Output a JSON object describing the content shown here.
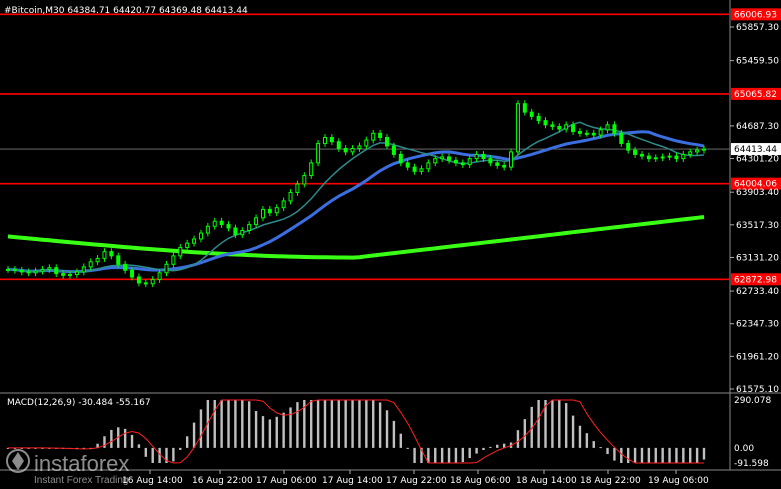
{
  "header": {
    "title": "#Bitcoin,M30  64384.71 64420.77 64369.48 64413.44"
  },
  "price_axis": [
    {
      "v": 65857.3,
      "t": "65857.30"
    },
    {
      "v": 65459.5,
      "t": "65459.50"
    },
    {
      "v": 64687.3,
      "t": "64687.30"
    },
    {
      "v": 64301.2,
      "t": "64301.20"
    },
    {
      "v": 63903.4,
      "t": "63903.40"
    },
    {
      "v": 63517.3,
      "t": "63517.30"
    },
    {
      "v": 63131.2,
      "t": "63131.20"
    },
    {
      "v": 62733.4,
      "t": "62733.40"
    },
    {
      "v": 62347.3,
      "t": "62347.30"
    },
    {
      "v": 61961.2,
      "t": "61961.20"
    },
    {
      "v": 61575.1,
      "t": "61575.10"
    }
  ],
  "levels": [
    {
      "price": 66006.93,
      "label": "66006.93"
    },
    {
      "price": 65065.82,
      "label": "65065.82"
    },
    {
      "price": 64004.06,
      "label": "64004.06"
    },
    {
      "price": 62872.98,
      "label": "62872.98"
    }
  ],
  "current_price": {
    "price": 64413.44,
    "label": "64413.44"
  },
  "time_axis": [
    "16 Aug 14:00",
    "16 Aug 22:00",
    "17 Aug 06:00",
    "17 Aug 14:00",
    "17 Aug 22:00",
    "18 Aug 06:00",
    "18 Aug 14:00",
    "18 Aug 22:00",
    "19 Aug 06:00"
  ],
  "macd": {
    "title": "MACD(12,26,9) -30.484 -55.167",
    "axis_top": "290.078",
    "axis_zero": "0.00",
    "axis_bottom": "-91.598",
    "histogram_max": 290.078,
    "histogram_min": -91.598
  },
  "watermark": {
    "brand": "instaforex",
    "tagline": "Instant Forex Trading"
  },
  "colors": {
    "background": "#000000",
    "candle": "#00ff00",
    "level_line": "#ff0000",
    "ma_fast": "#2e8b8b",
    "ma_mid": "#3b6fe0",
    "ma_slow": "#39ff14",
    "macd_hist": "#c0c0c0",
    "macd_signal": "#ff2020",
    "grid": "#3a3a3a"
  },
  "chart_data": {
    "type": "line",
    "title": "#Bitcoin,M30",
    "ohlc_last": {
      "open": 64384.71,
      "high": 64420.77,
      "low": 64369.48,
      "close": 64413.44
    },
    "ylim": [
      61500,
      66150
    ],
    "close_series": [
      62990,
      62980,
      62960,
      62950,
      62970,
      62990,
      63010,
      62940,
      62920,
      62930,
      62960,
      63020,
      63080,
      63120,
      63200,
      63150,
      63050,
      62980,
      62900,
      62830,
      62820,
      62870,
      62950,
      63050,
      63150,
      63250,
      63300,
      63350,
      63420,
      63500,
      63560,
      63520,
      63480,
      63400,
      63450,
      63520,
      63600,
      63700,
      63660,
      63720,
      63800,
      63900,
      64000,
      64100,
      64250,
      64480,
      64550,
      64500,
      64420,
      64380,
      64420,
      64450,
      64520,
      64600,
      64550,
      64450,
      64350,
      64250,
      64200,
      64150,
      64180,
      64250,
      64300,
      64320,
      64280,
      64250,
      64230,
      64300,
      64350,
      64300,
      64250,
      64220,
      64200,
      64380,
      64950,
      64850,
      64800,
      64750,
      64700,
      64680,
      64650,
      64700,
      64620,
      64600,
      64600,
      64580,
      64640,
      64700,
      64600,
      64480,
      64400,
      64350,
      64330,
      64300,
      64310,
      64320,
      64330,
      64300,
      64350,
      64380,
      64400,
      64413
    ]
  }
}
